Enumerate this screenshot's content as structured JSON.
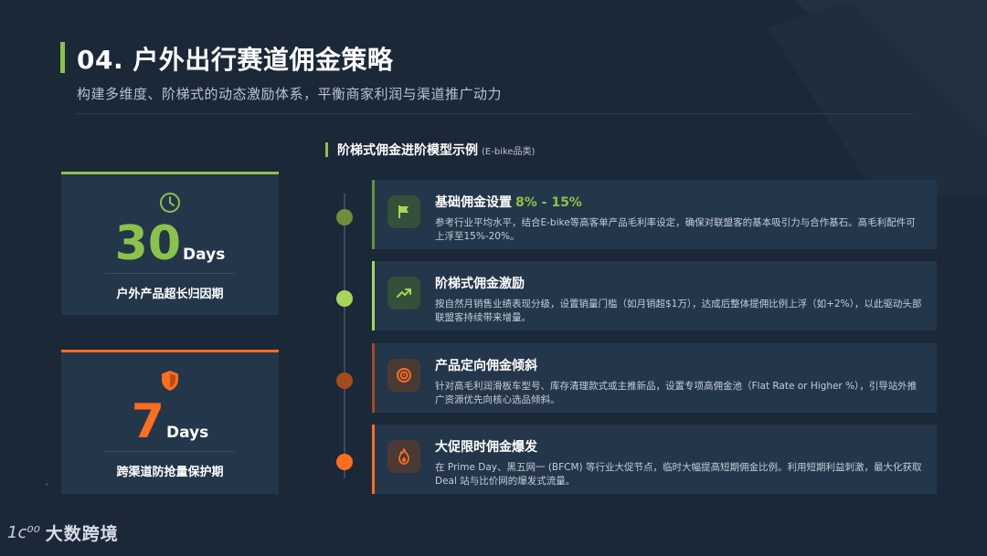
{
  "colors": {
    "green": "#8bc34a",
    "orange": "#ff6d1f",
    "card_bg": "#24364a",
    "page_bg": "#1b2838"
  },
  "header": {
    "title": "04. 户外出行赛道佣金策略",
    "subtitle": "构建多维度、阶梯式的动态激励体系，平衡商家利润与渠道推广动力"
  },
  "section": {
    "label": "阶梯式佣金进阶模型示例",
    "sub": "(E-bike品类)"
  },
  "stats": [
    {
      "icon": "clock-icon",
      "value": "30",
      "unit": "Days",
      "label": "户外产品超长归因期"
    },
    {
      "icon": "shield-icon",
      "value": "7",
      "unit": "Days",
      "label": "跨渠道防抢量保护期"
    }
  ],
  "steps": [
    {
      "icon": "flag-icon",
      "title": "基础佣金设置",
      "highlight": "8% - 15%",
      "desc": "参考行业平均水平，结合E-bike等高客单产品毛利率设定，确保对联盟客的基本吸引力与合作基石。高毛利配件可上浮至15%-20%。"
    },
    {
      "icon": "trend-up-icon",
      "title": "阶梯式佣金激励",
      "highlight": "",
      "desc": "按自然月销售业绩表现分级，设置销量门槛（如月销超$1万），达成后整体提佣比例上浮（如+2%），以此驱动头部联盟客持续带来增量。"
    },
    {
      "icon": "target-icon",
      "title": "产品定向佣金倾斜",
      "highlight": "",
      "desc": "针对高毛利润滑板车型号、库存清理款式或主推新品，设置专项高佣金池（Flat Rate or Higher %），引导站外推广资源优先向核心选品倾斜。"
    },
    {
      "icon": "fire-icon",
      "title": "大促限时佣金爆发",
      "highlight": "",
      "desc": "在 Prime Day、黑五网一 (BFCM) 等行业大促节点，临时大幅提高短期佣金比例。利用短期利益刺激，最大化获取 Deal 站与比价网的爆发式流量。"
    }
  ],
  "footer": {
    "logo_mark": "1ᴄ⁰⁰",
    "logo_text": "大数跨境"
  }
}
